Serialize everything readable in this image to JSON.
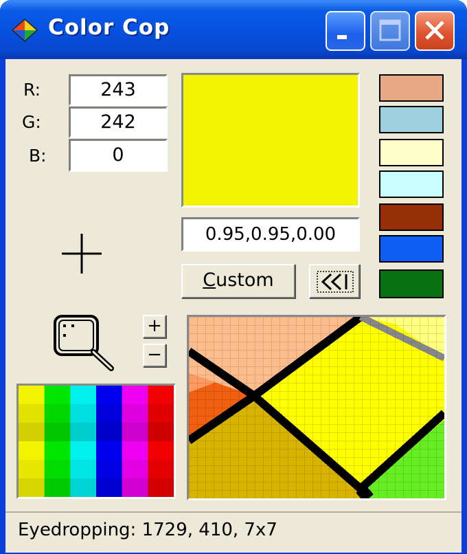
{
  "window": {
    "title": "Color Cop"
  },
  "titlebar": {
    "buttons": [
      "minimize-icon",
      "maximize-icon",
      "close-icon"
    ]
  },
  "rgb": {
    "r_label": "R:",
    "r_value": "243",
    "g_label": "G:",
    "g_value": "242",
    "b_label": "B:",
    "b_value": "0"
  },
  "current_color": "#f3f200",
  "decimal_value": "0.95,0.95,0.00",
  "buttons": {
    "custom_label": "Custom",
    "custom_mnemonic": "C",
    "custom_rest": "ustom",
    "expand_icon": "double-chevron-left-icon"
  },
  "history_swatches": [
    "#e9a986",
    "#9dcfdd",
    "#fefecb",
    "#c8fefe",
    "#962f06",
    "#0e5ef4",
    "#087112"
  ],
  "zoom": {
    "plus": "+",
    "minus": "−"
  },
  "palette_colors": [
    "#f3f300",
    "#00e600",
    "#00f0f0",
    "#0000ee",
    "#f000f0",
    "#f00000"
  ],
  "status": {
    "text": "Eyedropping: 1729, 410, 7x7"
  }
}
